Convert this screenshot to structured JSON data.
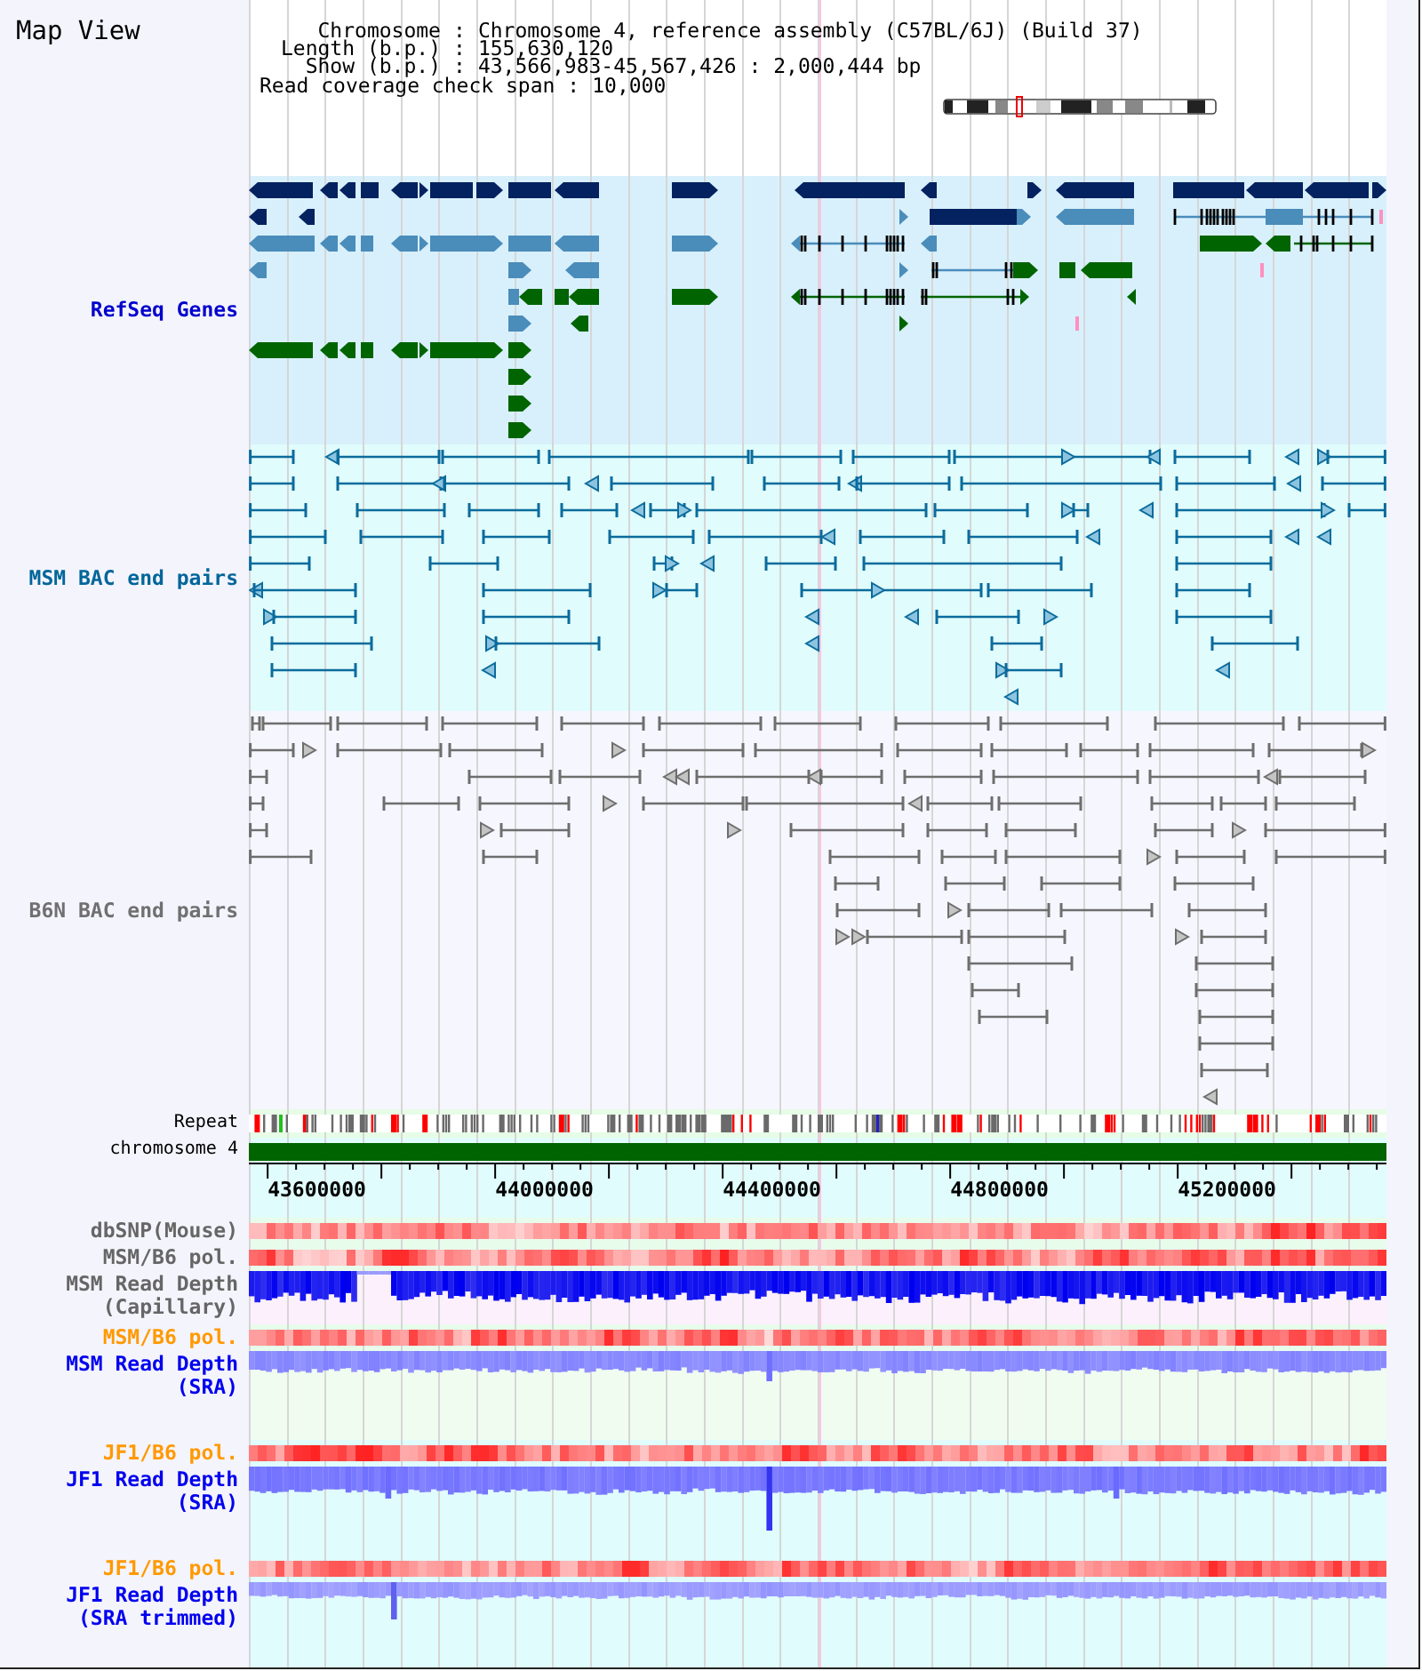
{
  "header": {
    "title": "Map View",
    "info": [
      {
        "kind": "field",
        "label": "Chromosome",
        "separator": ":",
        "value": "Chromosome 4, reference assembly (C57BL/6J) (Build 37)"
      },
      {
        "kind": "field",
        "label": "Length (b.p.)",
        "separator": ":",
        "value": "155,630,120"
      },
      {
        "kind": "field",
        "label": "Show (b.p.)",
        "separator": ":",
        "value": "43,566,983-45,567,426 : 2,000,444 bp"
      },
      {
        "kind": "note",
        "label": "Read coverage check span",
        "separator": ":",
        "value": "10,000"
      }
    ]
  },
  "tracks": [
    {
      "kind": "genes",
      "label": "RefSeq Genes",
      "color": "#0000cc"
    },
    {
      "kind": "bac",
      "label": "MSM BAC end pairs",
      "color": "#00669a"
    },
    {
      "kind": "bac",
      "label": "B6N BAC end pairs",
      "color": "#707070"
    },
    {
      "kind": "repeat",
      "label": "Repeat",
      "color": "#000000"
    },
    {
      "kind": "chromosome",
      "label": "chromosome 4",
      "color": "#000000"
    },
    {
      "kind": "axis",
      "tick_labels": [
        "43600000",
        "44000000",
        "44400000",
        "44800000",
        "45200000"
      ]
    },
    {
      "kind": "heat",
      "label": "dbSNP(Mouse)",
      "color": "#666666"
    },
    {
      "kind": "heat",
      "label": "MSM/B6 pol.",
      "color": "#666666"
    },
    {
      "kind": "depth",
      "label": "MSM Read Depth (Capillary)",
      "color": "#666666"
    },
    {
      "kind": "heat",
      "label": "MSM/B6 pol.",
      "color": "#ff9900"
    },
    {
      "kind": "depth",
      "label": "MSM Read Depth (SRA)",
      "color": "#0000ee"
    },
    {
      "kind": "heat",
      "label": "JF1/B6 pol.",
      "color": "#ff9900"
    },
    {
      "kind": "depth",
      "label": "JF1 Read Depth (SRA)",
      "color": "#0000ee"
    },
    {
      "kind": "heat",
      "label": "JF1/B6 pol.",
      "color": "#ff9900"
    },
    {
      "kind": "depth",
      "label": "JF1 Read Depth (SRA trimmed)",
      "color": "#0000ee"
    }
  ]
}
